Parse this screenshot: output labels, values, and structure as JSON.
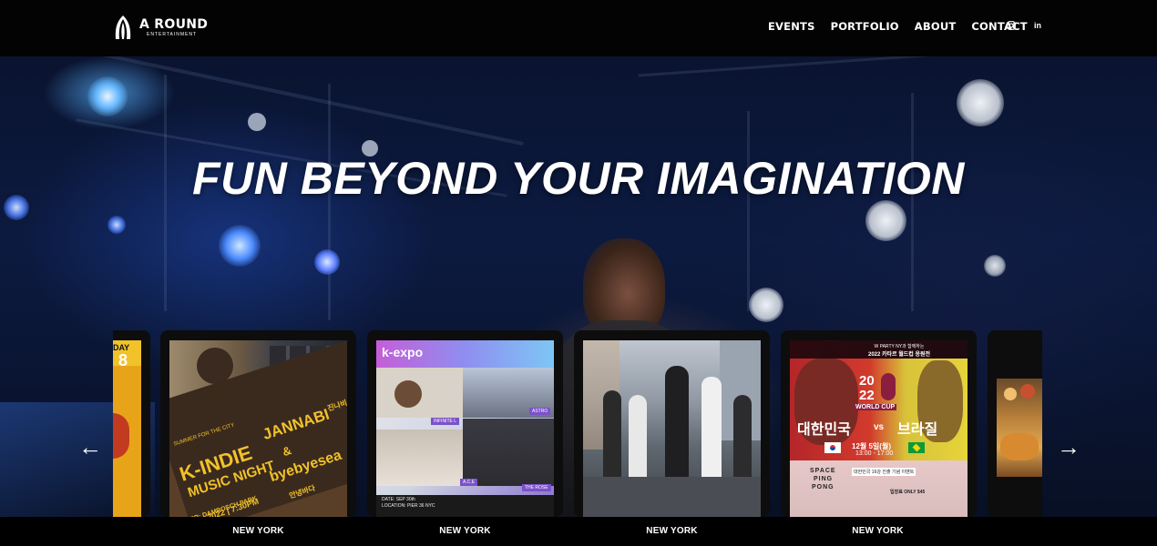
{
  "brand": {
    "name": "A ROUND",
    "sub": "ENTERTAINMENT"
  },
  "nav": {
    "items": [
      "EVENTS",
      "PORTFOLIO",
      "ABOUT",
      "CONTACT"
    ]
  },
  "social": {
    "instagram": "instagram-icon",
    "linkedin": "linkedin-icon",
    "linkedin_glyph": "in"
  },
  "hero": {
    "title": "FUN BEYOND YOUR IMAGINATION"
  },
  "carousel": {
    "prev_glyph": "←",
    "next_glyph": "→",
    "partial_left": {
      "badge": "DAY",
      "number": "8"
    },
    "cards": [
      {
        "city": "NEW YORK",
        "poster": {
          "l1": "SUMMER FOR THE CITY",
          "l2": "K-INDIE",
          "l3": "MUSIC NIGHT",
          "right1": "JANNABI",
          "right2": "진나비",
          "amp": "&",
          "right3": "byebyesea",
          "right4": "안녕바다",
          "footer": "2022 | 7:30PM",
          "footer2": "CENTER: DAMROSCH PARK"
        }
      },
      {
        "city": "NEW YORK",
        "poster": {
          "brand": "k-expo",
          "t1": "INFINITE L",
          "t2": "ASTRO",
          "t3": "A.C.E",
          "t4": "THE ROSE",
          "date": "DATE: SEP 30th",
          "loc": "LOCATION: PIER 36 NYC"
        }
      },
      {
        "city": "NEW YORK",
        "poster": {}
      },
      {
        "city": "NEW YORK",
        "poster": {
          "top1": "W PARTY NY과 함께하는",
          "top2": "2022 카타르 월드컵 응원전",
          "year1": "20",
          "year2": "22",
          "cup": "WORLD CUP",
          "match_left": "대한민국",
          "vs": "vs",
          "match_right": "브라질",
          "date": "12월 5일(월)",
          "time": "13:00 - 17:00",
          "venue1": "SPACE",
          "venue2": "PING",
          "venue3": "PONG",
          "event1": "대한민국 16강 진출 기념 이벤트",
          "price": "입장료 ONLY $45"
        }
      }
    ]
  }
}
